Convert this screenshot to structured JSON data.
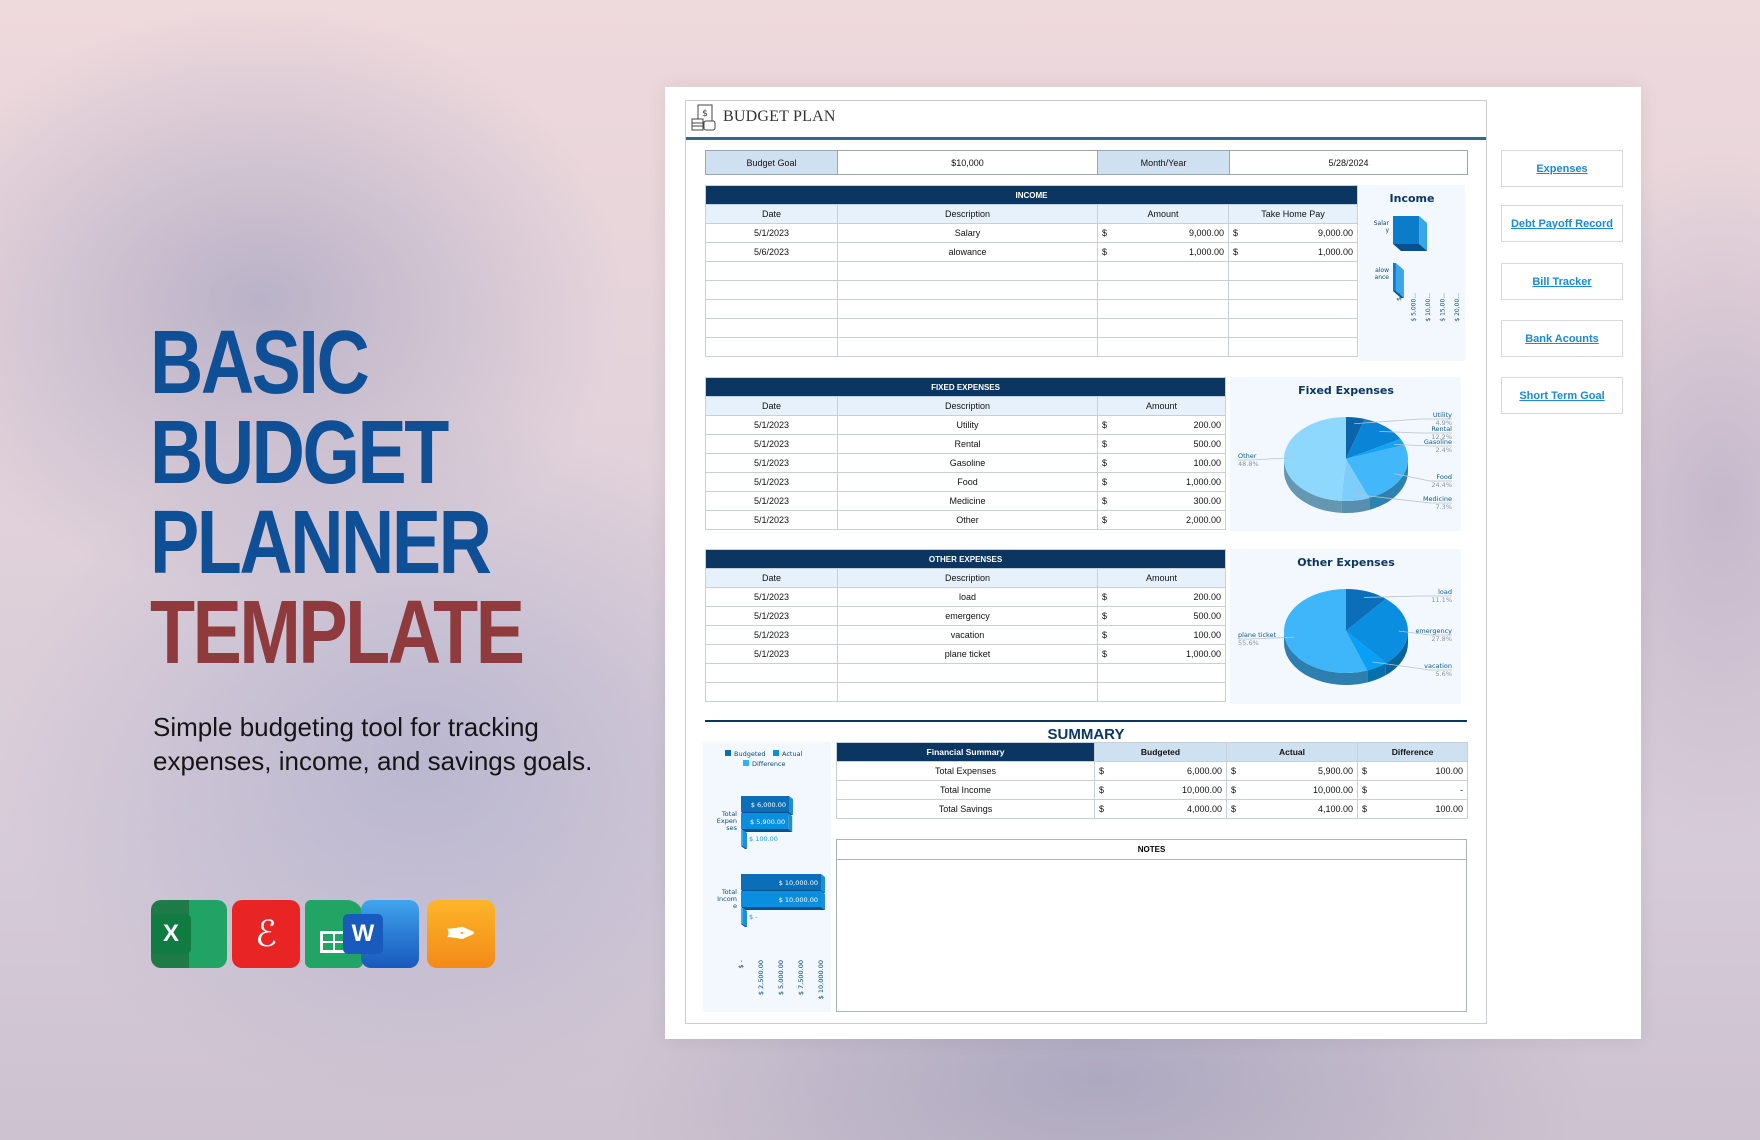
{
  "hero": {
    "title_lines": [
      "BASIC",
      "BUDGET",
      "PLANNER",
      "TEMPLATE"
    ],
    "subtitle_lines": [
      "Simple budgeting tool for tracking",
      "expenses, income, and savings goals."
    ],
    "app_icons": [
      "excel-icon",
      "pdf-icon",
      "google-sheets-icon",
      "word-icon",
      "pages-icon"
    ],
    "colors": {
      "title_blue": "#0f4f96",
      "title_red": "#8f3b3d"
    }
  },
  "document": {
    "title": "BUDGET PLAN",
    "goal_row": {
      "budget_goal_label": "Budget Goal",
      "budget_goal_value": "$10,000",
      "month_year_label": "Month/Year",
      "month_year_value": "5/28/2024"
    },
    "income": {
      "title": "INCOME",
      "columns": [
        "Date",
        "Description",
        "Amount",
        "Take Home Pay"
      ],
      "rows": [
        {
          "date": "5/1/2023",
          "description": "Salary",
          "amount": "9,000.00",
          "take_home": "9,000.00"
        },
        {
          "date": "5/6/2023",
          "description": "alowance",
          "amount": "1,000.00",
          "take_home": "1,000.00"
        }
      ],
      "currency": "$"
    },
    "fixed_expenses": {
      "title": "FIXED EXPENSES",
      "columns": [
        "Date",
        "Description",
        "Amount"
      ],
      "rows": [
        {
          "date": "5/1/2023",
          "description": "Utility",
          "amount": "200.00"
        },
        {
          "date": "5/1/2023",
          "description": "Rental",
          "amount": "500.00"
        },
        {
          "date": "5/1/2023",
          "description": "Gasoline",
          "amount": "100.00"
        },
        {
          "date": "5/1/2023",
          "description": "Food",
          "amount": "1,000.00"
        },
        {
          "date": "5/1/2023",
          "description": "Medicine",
          "amount": "300.00"
        },
        {
          "date": "5/1/2023",
          "description": "Other",
          "amount": "2,000.00"
        }
      ]
    },
    "other_expenses": {
      "title": "OTHER EXPENSES",
      "columns": [
        "Date",
        "Description",
        "Amount"
      ],
      "rows": [
        {
          "date": "5/1/2023",
          "description": "load",
          "amount": "200.00"
        },
        {
          "date": "5/1/2023",
          "description": "emergency",
          "amount": "500.00"
        },
        {
          "date": "5/1/2023",
          "description": "vacation",
          "amount": "100.00"
        },
        {
          "date": "5/1/2023",
          "description": "plane ticket",
          "amount": "1,000.00"
        }
      ]
    },
    "summary": {
      "title": "SUMMARY",
      "columns": [
        "Financial Summary",
        "Budgeted",
        "Actual",
        "Difference"
      ],
      "rows": [
        {
          "label": "Total Expenses",
          "budgeted": "6,000.00",
          "actual": "5,900.00",
          "difference": "100.00"
        },
        {
          "label": "Total Income",
          "budgeted": "10,000.00",
          "actual": "10,000.00",
          "difference": "-"
        },
        {
          "label": "Total Savings",
          "budgeted": "4,000.00",
          "actual": "4,100.00",
          "difference": "100.00"
        }
      ]
    },
    "notes": {
      "title": "NOTES",
      "content": ""
    }
  },
  "nav_links": [
    "Expenses",
    "Debt Payoff Record",
    "Bill Tracker",
    "Bank Acounts",
    "Short Term Goal"
  ],
  "chart_data": [
    {
      "type": "bar",
      "title": "Income",
      "orientation": "horizontal",
      "categories": [
        "Salary",
        "alowance"
      ],
      "category_labels": [
        "Salar y",
        "alow ance"
      ],
      "values": [
        9000,
        1000
      ],
      "x_ticks": [
        "$ -",
        "$ 5,000...",
        "$ 10,00...",
        "$ 15,00...",
        "$ 20,00..."
      ],
      "xlim": [
        0,
        20000
      ]
    },
    {
      "type": "pie",
      "title": "Fixed Expenses",
      "categories": [
        "Utility",
        "Rental",
        "Gasoline",
        "Food",
        "Medicine",
        "Other"
      ],
      "values": [
        200,
        500,
        100,
        1000,
        300,
        2000
      ],
      "percent_labels": [
        "4.9%",
        "12.2%",
        "2.4%",
        "24.4%",
        "7.3%",
        "48.8%"
      ],
      "colors": [
        "#0a64a8",
        "#0a84d6",
        "#12a4f5",
        "#42b8fb",
        "#7fcdfa",
        "#8fd8fd"
      ]
    },
    {
      "type": "pie",
      "title": "Other Expenses",
      "categories": [
        "load",
        "emergency",
        "vacation",
        "plane ticket"
      ],
      "values": [
        200,
        500,
        100,
        1000
      ],
      "percent_labels": [
        "11.1%",
        "27.8%",
        "5.6%",
        "55.6%"
      ],
      "colors": [
        "#0a6fb8",
        "#0a8ee0",
        "#08a0f6",
        "#3fb6fa"
      ]
    },
    {
      "type": "bar",
      "title": "",
      "orientation": "horizontal",
      "categories": [
        "Total Expenses",
        "Total Income"
      ],
      "category_labels": [
        "Total Expen ses",
        "Total Incom e"
      ],
      "series": [
        {
          "name": "Budgeted",
          "values": [
            6000,
            10000
          ],
          "labels": [
            "$ 6,000.00",
            "$ 10,000.00"
          ],
          "color": "#0a6fb8"
        },
        {
          "name": "Actual",
          "values": [
            5900,
            10000
          ],
          "labels": [
            "$ 5,900.00",
            "$ 10,000.00"
          ],
          "color": "#0a8ee0"
        },
        {
          "name": "Difference",
          "values": [
            100,
            0
          ],
          "labels": [
            "$ 100.00",
            "$ -"
          ],
          "color": "#2fb0f8"
        }
      ],
      "x_ticks": [
        "$ -",
        "$ 2,500.00",
        "$ 5,000.00",
        "$ 7,500.00",
        "$ 10,000.00"
      ],
      "xlim": [
        0,
        10000
      ],
      "legend": "top"
    }
  ]
}
